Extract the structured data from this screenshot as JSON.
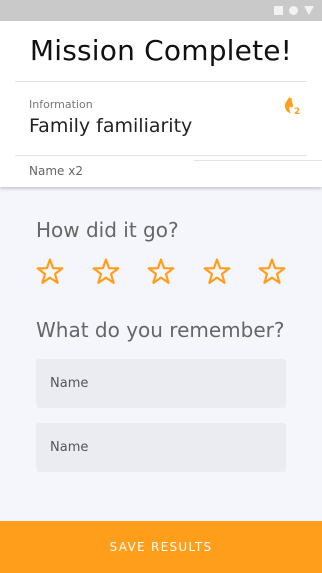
{
  "header": {
    "title": "Mission Complete!",
    "info_label": "Information",
    "info_value": "Family familiarity",
    "name_count": "Name x2",
    "fire_icon": "fire-icon",
    "fire_badge": "2"
  },
  "rating": {
    "question": "How did it go?",
    "max_stars": 5,
    "selected": 0,
    "star_icon": "star-outline-icon"
  },
  "memory": {
    "question": "What do you remember?",
    "fields": [
      {
        "placeholder": "Name",
        "value": ""
      },
      {
        "placeholder": "Name",
        "value": ""
      }
    ]
  },
  "footer": {
    "save_label": "SAVE RESULTS"
  },
  "colors": {
    "accent": "#ff9e1b",
    "status_bar": "#c9c9c9",
    "field_bg": "#ebecf1",
    "page_bg": "#f5f6fb"
  }
}
